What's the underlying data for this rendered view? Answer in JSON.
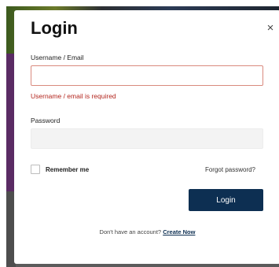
{
  "modal": {
    "title": "Login",
    "close_icon": "close-icon",
    "close_glyph": "×"
  },
  "form": {
    "username_label": "Username / Email",
    "username_value": "",
    "username_error": "Username / email is required",
    "password_label": "Password",
    "password_value": "",
    "remember_label": "Remember me",
    "remember_checked": false,
    "forgot_label": "Forgot password?",
    "submit_label": "Login"
  },
  "footer": {
    "prompt": "Don't have an account?",
    "link_label": "Create Now"
  },
  "colors": {
    "primary": "#0d2f52",
    "error": "#b3261e",
    "error_border": "#d98a7e"
  }
}
